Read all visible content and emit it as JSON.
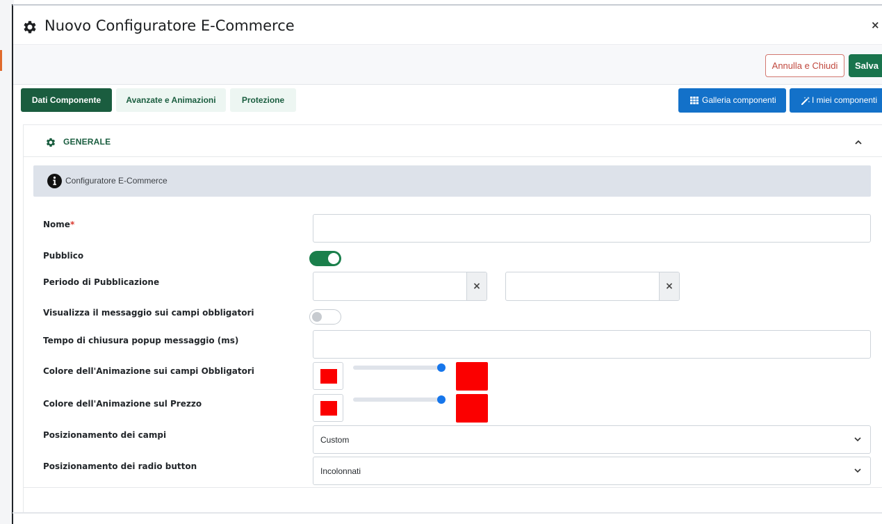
{
  "dialog": {
    "title": "Nuovo Configuratore E-Commerce",
    "close_symbol": "×"
  },
  "actions": {
    "cancel_label": "Annulla e Chiudi",
    "save_label": "Salva"
  },
  "tabs": [
    {
      "label": "Dati Componente",
      "active": true
    },
    {
      "label": "Avanzate e Animazioni",
      "active": false
    },
    {
      "label": "Protezione",
      "active": false
    }
  ],
  "toolbar": {
    "gallery_label": "Galleria componenti",
    "gallery_icon": "grid-icon",
    "mine_label": "I miei componenti",
    "mine_icon": "magic-wand-icon"
  },
  "section": {
    "title": "GENERALE",
    "icon": "gear-icon",
    "expanded": true
  },
  "info": {
    "icon": "info-circle-icon",
    "text": "Configuratore E-Commerce"
  },
  "form": {
    "nome": {
      "label": "Nome",
      "required_mark": "*",
      "value": ""
    },
    "pubblico": {
      "label": "Pubblico",
      "checked": true
    },
    "periodo": {
      "label": "Periodo di Pubblicazione",
      "from": "",
      "to": "",
      "clear_symbol": "×"
    },
    "visualizza": {
      "label": "Visualizza il messaggio sui campi obbligatori",
      "checked": false
    },
    "tempo": {
      "label": "Tempo di chiusura popup messaggio (ms)",
      "value": ""
    },
    "colore_obbligatori": {
      "label": "Colore dell'Animazione sui campi Obbligatori",
      "color": "#fb0000",
      "opacity": 1.0
    },
    "colore_prezzo": {
      "label": "Colore dell'Animazione sul Prezzo",
      "color": "#fb0000",
      "opacity": 1.0
    },
    "posizionamento_campi": {
      "label": "Posizionamento dei campi",
      "value": "Custom"
    },
    "posizionamento_radio": {
      "label": "Posizionamento dei radio button",
      "value": "Incolonnati"
    }
  },
  "colors": {
    "brand_green": "#1a5d3f",
    "save_green": "#19744d",
    "toggle_green": "#1a7f4b",
    "primary_blue": "#1371c9",
    "cancel_red": "#c0483e",
    "info_bg": "#dde2ea"
  }
}
